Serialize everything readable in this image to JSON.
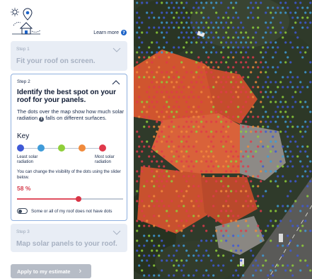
{
  "header": {
    "learn_more": "Learn more",
    "learn_more_icon": "?"
  },
  "step1": {
    "label": "Step 1",
    "title": "Fit your roof on screen."
  },
  "step2": {
    "label": "Step 2",
    "title": "Identify the best spot on your roof for your panels.",
    "desc_before": "The dots over the map show how much solar radiation ",
    "desc_info": "i",
    "desc_after": " falls on different surfaces.",
    "key_title": "Key",
    "key_colors": [
      "#3e59d6",
      "#3f9bd9",
      "#8fcf3a",
      "#f08a3c",
      "#e0394b"
    ],
    "key_least": "Least solar radiation",
    "key_most": "Most solar radiation",
    "visibility_text": "You can change the visibility of the dots using the slider below.",
    "percent_label": "58 %",
    "slider_value": 0.58,
    "toggle_label": "Some or all of my roof does not have dots",
    "toggle_on": false
  },
  "step3": {
    "label": "Step 3",
    "title": "Map solar panels to your roof."
  },
  "apply_button": {
    "label": "Apply to my estimate",
    "arrow": "›"
  },
  "colors": {
    "accent": "#1e64c8",
    "red": "#d93445",
    "card_bg": "#e8edf5",
    "active_border": "#8fb0df"
  }
}
